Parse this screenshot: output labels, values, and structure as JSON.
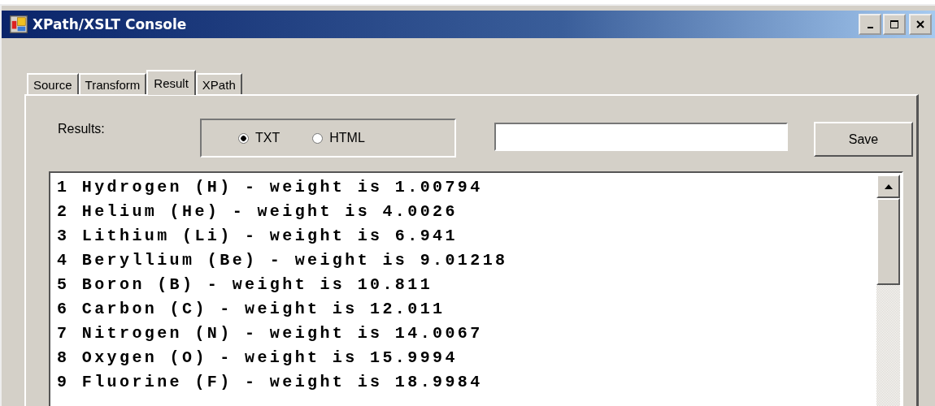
{
  "window": {
    "title": "XPath/XSLT Console"
  },
  "tabs": [
    {
      "label": "Source",
      "selected": false
    },
    {
      "label": "Transform",
      "selected": false
    },
    {
      "label": "Result",
      "selected": true
    },
    {
      "label": "XPath",
      "selected": false
    }
  ],
  "results_label": "Results:",
  "format_options": [
    {
      "label": "TXT",
      "selected": true
    },
    {
      "label": "HTML",
      "selected": false
    }
  ],
  "save_button": "Save",
  "result_lines": [
    "1 Hydrogen (H) - weight is 1.00794",
    "2 Helium (He) - weight is 4.0026",
    "3 Lithium (Li) - weight is 6.941",
    "4 Beryllium (Be) - weight is 9.01218",
    "5 Boron (B) - weight is 10.811",
    "6 Carbon (C) - weight is 12.011",
    "7 Nitrogen (N) - weight is 14.0067",
    "8 Oxygen (O) - weight is 15.9994",
    "9 Fluorine (F) - weight is 18.9984"
  ]
}
